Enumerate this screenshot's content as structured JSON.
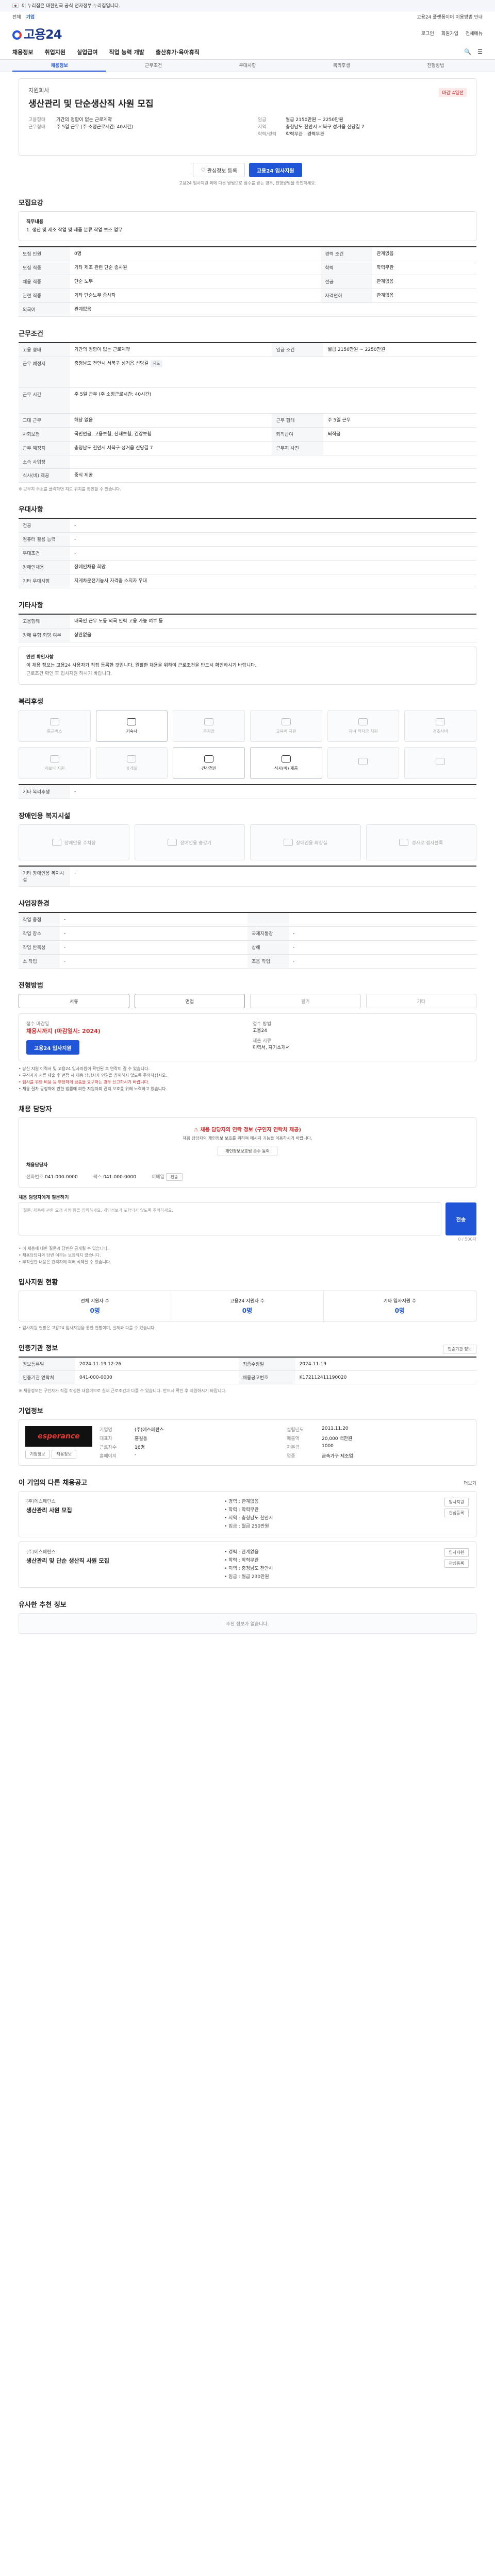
{
  "gov_bar": "이 누리집은 대한민국 공식 전자정부 누리집입니다.",
  "util": {
    "left": "전체",
    "center": "기업",
    "right_notice": "고용24 플랫폼이어 이용방법 안내"
  },
  "header": {
    "logo": "고용24",
    "links": [
      "로그인",
      "회원가입",
      "전체메뉴"
    ]
  },
  "gnb": {
    "items": [
      "채용정보",
      "취업지원",
      "실업급여",
      "직업 능력 개발",
      "출산휴가·육아휴직"
    ],
    "right": [
      "검색",
      "메뉴"
    ]
  },
  "subnav": [
    "채용정보",
    "근무조건",
    "우대사항",
    "복리후생",
    "전형방법"
  ],
  "summary": {
    "company": "지원회사",
    "title": "생산관리 및 단순생산직 사원 모집",
    "badge": "마감 4일전",
    "left": [
      {
        "k": "고용형태",
        "v": "기간의 정함이 없는 근로계약"
      },
      {
        "k": "근무형태",
        "v": "주 5일 근무 (주 소정근로시간: 40시간)"
      }
    ],
    "right": [
      {
        "k": "임금",
        "v": "월급 2150만원 ~ 2250만원"
      },
      {
        "k": "지역",
        "v": "충청남도 천안시 서북구 성거읍 신당길 7"
      },
      {
        "k": "학력/경력",
        "v": "학력무관 · 경력무관"
      }
    ],
    "buttons": {
      "save": "관심정보 등록",
      "apply": "고용24 입사지원"
    },
    "note": "고용24 입사지원 외에 다른 방법으로 접수를 받는 경우, 전형방법을 확인하세요."
  },
  "sec_job": {
    "title": "모집요강",
    "label": "직무내용",
    "text": "1. 생산 및 제조 작업 및 제품 분류 작업 보조 업무"
  },
  "recruit_table": [
    [
      "모집 인원",
      "0명",
      "경력 조건",
      "관계없음"
    ],
    [
      "모집 직종",
      "기타 제조 관련 단순 종사원",
      "학력",
      "학력무관"
    ],
    [
      "채용 직종",
      "단순 노무",
      "전공",
      "관계없음"
    ],
    [
      "관련 직종",
      "기타 단순노무 종사자",
      "자격면허",
      "관계없음"
    ],
    [
      "외국어",
      "관계없음",
      "",
      "",
      ""
    ]
  ],
  "work_title": "근무조건",
  "work_table": [
    [
      "고용 형태",
      "기간의 정함이 없는 근로계약",
      "임금 조건",
      "월급 2150만원 ~ 2250만원"
    ],
    [
      "근무 예정지",
      "충청남도 천안시 서북구 성거읍 신당길",
      "",
      ""
    ],
    [
      "근무 시간",
      "주 5일 근무 (주 소정근로시간: 40시간)",
      "",
      ""
    ],
    [
      "교대 근무",
      "해당 없음",
      "근무 형태",
      "주 5일 근무"
    ],
    [
      "사회보험",
      "국민연금, 고용보험, 산재보험, 건강보험",
      "퇴직급여",
      "퇴직금"
    ],
    [
      "근무 예정지",
      "충청남도 천안시 서북구 성거읍 신당길 7",
      "근무지 사진",
      ""
    ],
    [
      "소속 사업장",
      "",
      "",
      " "
    ],
    [
      "식사(비) 제공",
      "중식 제공",
      "",
      ""
    ]
  ],
  "work_note": "※ 근무지 주소를 클릭하면 지도 위치를 확인할 수 있습니다.",
  "prefer_title": "우대사항",
  "prefer_table": [
    [
      "전공",
      "-"
    ],
    [
      "컴퓨터 활용 능력",
      "-"
    ],
    [
      "우대조건",
      "-"
    ],
    [
      "장애인채용",
      "장애인채용 희망"
    ],
    [
      "기타 우대사항",
      "지게차운전기능사 자격증 소지자 우대"
    ]
  ],
  "etc_title": "기타사항",
  "etc_table": [
    [
      "고용형태",
      "내국인 근무 노동 외국 인력 고용 가능 여부 등"
    ],
    [
      "장애 유형 희망 여부",
      "상관없음"
    ]
  ],
  "etc_box": {
    "head": "안전 확인사항",
    "text": "이 채용 정보는 고용24 사용자가 직접 등록한 것입니다. 원활한 채용을 위하여 근로조건을 반드시 확인하시기 바랍니다.",
    "sub": "근로조건 확인 후 입사지원 하시기 바랍니다."
  },
  "welfare_title": "복리후생",
  "welfare": [
    {
      "label": "통근버스",
      "on": false
    },
    {
      "label": "기숙사",
      "on": true
    },
    {
      "label": "주차장",
      "on": false
    },
    {
      "label": "교육비 지원",
      "on": false
    },
    {
      "label": "자녀 학자금 지원",
      "on": false
    },
    {
      "label": "경조사비",
      "on": false
    },
    {
      "label": "의료비 지원",
      "on": false
    },
    {
      "label": "휴게실",
      "on": false
    },
    {
      "label": "건강검진",
      "on": true
    },
    {
      "label": "식사(비) 제공",
      "on": true
    },
    {
      "label": "",
      "on": false
    },
    {
      "label": "",
      "on": false
    }
  ],
  "welfare_etc": [
    "기타 복리후생",
    "-"
  ],
  "disab_title": "장애인용 복지시설",
  "disab": [
    "장애인용 주차장",
    "장애인용 승강기",
    "장애인용 화장실",
    "경사로·점자블록"
  ],
  "disab_etc": [
    "기타 장애인용 복지시설",
    "-"
  ],
  "place_title": "사업장환경",
  "place_table": [
    [
      "작업 중점",
      "-",
      "",
      ""
    ],
    [
      "작업 장소",
      "-",
      "국제지통장",
      "-"
    ],
    [
      "작업 반복성",
      "-",
      "상해",
      "-"
    ],
    [
      "소 작업",
      "-",
      "조음 작업",
      "-"
    ]
  ],
  "select_title": "전형방법",
  "select_opts": [
    {
      "label": "서류",
      "on": true
    },
    {
      "label": "면접",
      "on": true
    },
    {
      "label": "필기",
      "on": false
    },
    {
      "label": "기타",
      "on": false
    }
  ],
  "apply": {
    "l1": "접수 마감일",
    "deadline": "채용시까지 (마감일시: 2024)",
    "l2": "접수 방법",
    "v2": "고용24",
    "l3": "제출 서류",
    "v3": "이력서, 자기소개서",
    "btn": "고용24 입사지원"
  },
  "apply_notes": [
    "• 당신 지원 이력서 및 고용24 입사지원이 확인된 후 연락이 갈 수 있습니다.",
    "• 구직자가 서류 제출 후 면접 시 채용 담당자가 인권을 침해하지 않도록 주의하십시오.",
    "• 입사를 위한 비용 등 부당하게 금품을 요구하는 경우 신고하시기 바랍니다.",
    "• 채용 절차 공정화에 관한 법률에 의한 지원자의 권리 보호를 위해 노력하고 있습니다."
  ],
  "mgr_title": "채용 담당자",
  "mgr": {
    "alert": "채용 담당자의 연락 정보 (구인자 연락처 제공)",
    "alert_sub": "채용 담당자의 개인정보 보호를 위하여 메시지 기능을 이용하시기 바랍니다.",
    "alert_btn": "개인정보보호법 준수 동의",
    "name_l": "채용담당자",
    "phone_l": "전화번호",
    "phone": "041-000-0000",
    "fax_l": "팩스",
    "fax": "041-000-0000",
    "email_l": "이메일",
    "email": "전송"
  },
  "msg": {
    "label": "채용 담당자에게 질문하기",
    "placeholder": "질문, 채용에 관한 요청 사항 등을 입력하세요. 개인정보가 포함되지 않도록 주의하세요.",
    "count": "0 / 500자",
    "send": "전송"
  },
  "msg_notes": [
    "• 이 채용에 대한 질문과 답변은 공개될 수 있습니다.",
    "• 채용담당자의 답변 여부는 보장되지 않습니다.",
    "• 부적절한 내용은 관리자에 의해 삭제될 수 있습니다."
  ],
  "stat_title": "입사지원 현황",
  "stats": [
    {
      "k": "전체 지원자 수",
      "v": "0명"
    },
    {
      "k": "고용24 지원자 수",
      "v": "0명"
    },
    {
      "k": "기타 입사지원 수",
      "v": "0명"
    }
  ],
  "stat_note": "• 입사지원 현황은 고용24 입사지원을 통한 현황이며, 실제와 다를 수 있습니다.",
  "info_title": "인증기관 정보",
  "info_btn": "인증기관 정보",
  "info_table": [
    [
      "정보등록일",
      "2024-11-19 12:26",
      "최종수정일",
      "2024-11-19"
    ],
    [
      "인증기관 연락처",
      "041-000-0000",
      "채용공고번호",
      "K172112411190020"
    ]
  ],
  "info_note": "※ 채용정보는 구인자가 직접 작성한 내용이므로 실제 근로조건과 다를 수 있습니다. 반드시 확인 후 지원하시기 바랍니다.",
  "corp_title": "기업정보",
  "corp": {
    "logo_a": "esperance",
    "logo_b": "",
    "name_k": "기업명",
    "name": "(주)에스페란스",
    "rep_k": "대표자",
    "rep": "홍길동",
    "emp_k": "근로자수",
    "emp": "16명",
    "found_k": "설립년도",
    "found": "2011.11.20",
    "sales_k": "매출액",
    "sales": "20,000 백만원",
    "cap_k": "자본금",
    "cap": "1000",
    "web_k": "홈페이지",
    "web": "-",
    "type_k": "업종",
    "type": "금속가구 제조업",
    "btn1": "기업정보",
    "btn2": "채용정보"
  },
  "rel_title": "이 기업의 다른 채용공고",
  "rel_more": "더보기",
  "rel": [
    {
      "company": "(주)에스페란스",
      "title": "생산관리 사원 모집",
      "meta": [
        "• 경력 : 관계없음",
        "• 학력 : 학력무관",
        "• 지역 : 충청남도 천안시",
        "• 임금 : 월급 250만원"
      ],
      "btns": [
        "입사지원",
        "관심등록"
      ]
    },
    {
      "company": "(주)에스페란스",
      "title": "생산관리 및 단순 생산직 사원 모집",
      "meta": [
        "• 경력 : 관계없음",
        "• 학력 : 학력무관",
        "• 지역 : 충청남도 천안시",
        "• 임금 : 월급 230만원"
      ],
      "btns": [
        "입사지원",
        "관심등록"
      ]
    }
  ],
  "similar_title": "유사한 추천 정보",
  "similar_empty": "추천 정보가 없습니다."
}
